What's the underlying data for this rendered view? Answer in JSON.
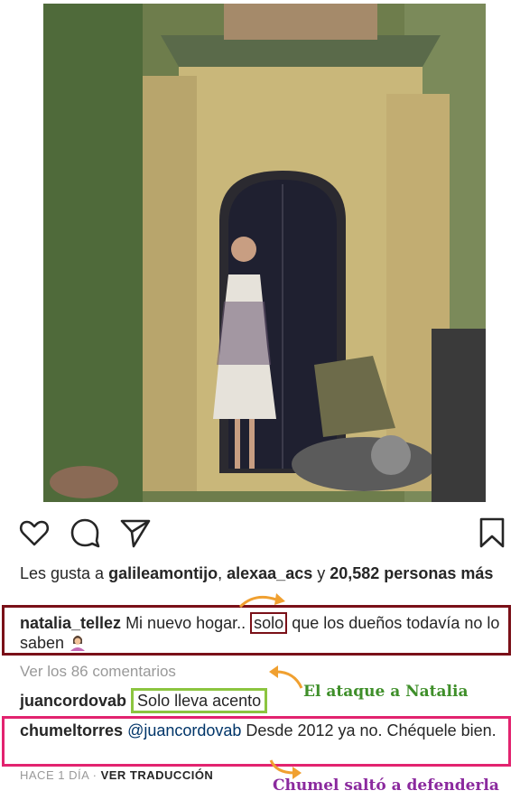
{
  "post": {
    "likes_prefix": "Les gusta a ",
    "liker1": "galileamontijo",
    "liker_sep": ", ",
    "liker2": "alexaa_acs",
    "likes_and": " y ",
    "likes_count": "20,582 personas más",
    "caption_user": "natalia_tellez",
    "caption_pre": " Mi nuevo hogar.. ",
    "caption_highlight": "solo",
    "caption_post": " que los dueños todavía no lo saben",
    "caption_emoji": "woman-shrugging-emoji",
    "view_comments": "Ver los 86 comentarios",
    "comments": [
      {
        "user": "juancordovab",
        "text": "Solo lleva acento"
      },
      {
        "user": "chumeltorres",
        "mention": "@juancordovab",
        "text": " Desde 2012 ya no. Chéquele bien."
      }
    ],
    "time": "HACE 1 DÍA",
    "meta_sep": " · ",
    "translate": "VER TRADUCCIÓN"
  },
  "annotations": {
    "attack": "El ataque a Natalia",
    "defense": "Chumel saltó a defenderla"
  },
  "colors": {
    "caption_box": "#7a1018",
    "comment1_box": "#8cc540",
    "comment2_box": "#e2236f",
    "arrow": "#f0a030"
  },
  "icons": [
    "heart-icon",
    "comment-icon",
    "share-icon",
    "bookmark-icon"
  ]
}
